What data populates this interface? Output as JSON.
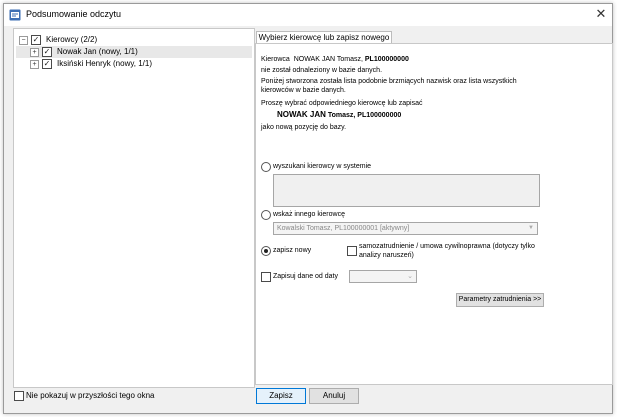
{
  "window": {
    "title": "Podsumowanie odczytu",
    "close_glyph": "✕"
  },
  "tree": {
    "root": {
      "label": "Kierowcy (2/2)",
      "expander": "−",
      "checked": true
    },
    "children": [
      {
        "label": "Nowak Jan (nowy, 1/1)",
        "expander": "+",
        "checked": true,
        "selected": true
      },
      {
        "label": "Iksiński Henryk (nowy, 1/1)",
        "expander": "+",
        "checked": true,
        "selected": false
      }
    ]
  },
  "tab": {
    "label": "Wybierz kierowcę lub zapisz nowego"
  },
  "panel": {
    "line1_prefix": "Kierowca",
    "line1_name": "NOWAK JAN Tomasz,",
    "line1_id": "PL100000000",
    "line2": "nie został odnaleziony w bazie danych.",
    "line3": "Poniżej stworzona została lista podobnie brzmiących nazwisk oraz lista wszystkich",
    "line4": "kierowców w bazie danych.",
    "line5": "Proszę wybrać odpowiedniego kierowcę lub zapisać",
    "line6_name": "NOWAK JAN",
    "line6_rest": "Tomasz, PL100000000",
    "line7": "jako nową pozycję do bazy.",
    "opt_found": "wyszukani kierowcy w systemie",
    "opt_other": "wskaż innego kierowcę",
    "other_combo_value": "Kowalski Tomasz, PL100000001 [aktywny]",
    "opt_new": "zapisz nowy",
    "selected_option": "zapisz nowy",
    "self_employed_label": "samozatrudnienie / umowa cywilnoprawna (dotyczy tylko analizy naruszeń)",
    "self_employed_line1": "samozatrudnienie / umowa cywilnoprawna (dotyczy tylko",
    "self_employed_line2": "analizy naruszeń)",
    "save_from_label": "Zapisuj dane od daty",
    "date_combo_value": "",
    "params_button": "Parametry zatrudnienia >>"
  },
  "footer": {
    "dont_show_label": "Nie pokazuj w przyszłości tego okna",
    "save_button": "Zapisz",
    "cancel_button": "Anuluj"
  },
  "icons": {
    "expander_closed": "+",
    "expander_open": "−",
    "check": "✓",
    "dropdown": "▼"
  },
  "colors": {
    "window_bg": "#f0f0f0",
    "selection": "#e8e8e8",
    "primary_border": "#0078d7"
  }
}
